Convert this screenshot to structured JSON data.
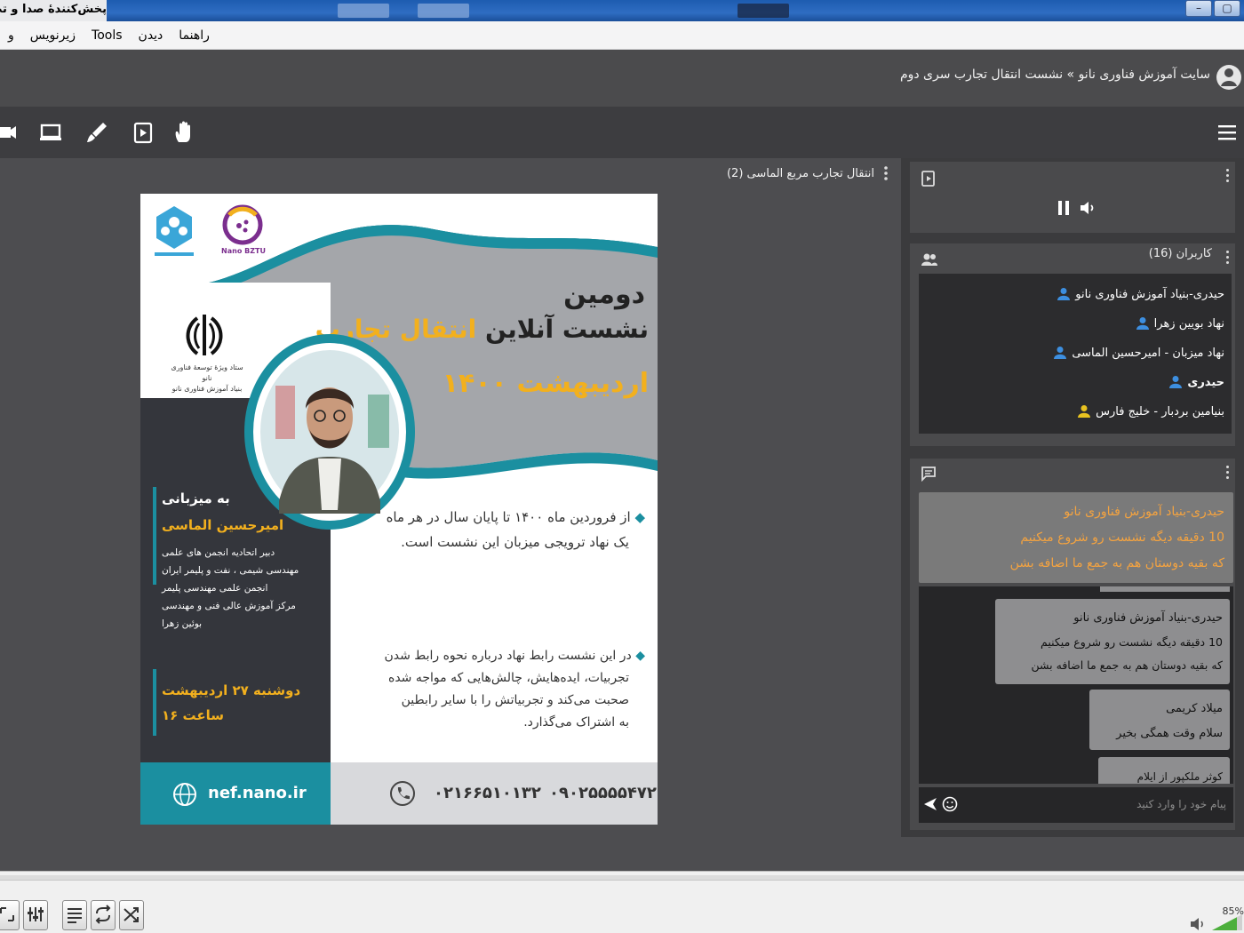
{
  "window": {
    "title": "پخش‌کنندهٔ صدا و تصویر"
  },
  "menu": {
    "items": [
      "راهنما",
      "دیدن",
      "Tools",
      "زیرنویس",
      "و"
    ]
  },
  "header": {
    "breadcrumb": "سایت آموزش فناوری نانو » نشست انتقال تجارب سری دوم"
  },
  "toolbar": {
    "tools": [
      "hand-icon",
      "presentation-icon",
      "pen-icon",
      "screen-icon",
      "camera-icon"
    ],
    "menu_icon": "hamburger-icon"
  },
  "presentation": {
    "title": "انتقال تجارب مربع الماسی (2)"
  },
  "slide": {
    "logo_right_caption": "Nano BZTU",
    "emblem_caption": "ستاد ویژهٔ توسعهٔ فناوری نانو\nبنیاد آموزش فناوری نانو",
    "heading_1": "دومین",
    "heading_2a": "نشست آنلاین",
    "heading_2b": "انتقال تجارب",
    "heading_3": "اردیبهشت ۱۴۰۰",
    "host_label": "به میزبانی",
    "host_name": "امیرحسین الماسی",
    "host_roles": [
      "دبیر اتحادیه انجمن های علمی",
      "مهندسی شیمی ، نفت و پلیمر ایران",
      "انجمن علمی مهندسی پلیمر",
      "مرکز آموزش عالی فنی و مهندسی",
      "بوئین زهرا"
    ],
    "date_line": "دوشنبه ۲۷ اردیبهشت",
    "time_line": "ساعت ۱۶",
    "bullet_1a": "از فروردین ماه ۱۴۰۰ تا پایان سال در هر ماه",
    "bullet_1b": "یک نهاد ترویجی میزبان این نشست است.",
    "bullet_2": [
      "در این نشست رابط نهاد درباره نحوه رابط شدن",
      "تجربیات، ایده‌هایش، چالش‌هایی که مواجه شده",
      "صحبت می‌کند و تجربیاتش را با سایر رابطین",
      "به اشتراک می‌گذارد."
    ],
    "website": "nef.nano.ir",
    "phone_1": "۰۲۱۶۶۵۱۰۱۳۲",
    "phone_2": "۰۹۰۲۵۵۵۵۴۷۲"
  },
  "users": {
    "title": "کاربران (16)",
    "list": [
      {
        "name": "حیدری-بنیاد آموزش فناوری نانو",
        "color": "#3d8fe0",
        "bold": false
      },
      {
        "name": "نهاد بویین زهرا",
        "color": "#3d8fe0",
        "bold": false
      },
      {
        "name": "نهاد میزبان - امیرحسین الماسی",
        "color": "#3d8fe0",
        "bold": false
      },
      {
        "name": "حیدری",
        "color": "#3d8fe0",
        "bold": true
      },
      {
        "name": "بنیامین بردبار - خلیج فارس",
        "color": "#e8c220",
        "bold": false
      }
    ]
  },
  "chat": {
    "pinned": [
      "حیدری-بنیاد آموزش فناوری نانو",
      "10 دقیقه دیگه نشست رو شروع میکنیم",
      "که بقیه دوستان هم به جمع ما اضافه بشن"
    ],
    "messages": [
      {
        "sender": "حیدری-بنیاد آموزش فناوری نانو",
        "lines": [
          "10 دقیقه دیگه نشست رو شروع میکنیم",
          "که بقیه دوستان هم به جمع ما اضافه بشن"
        ]
      },
      {
        "sender": "میلاد کریمی",
        "lines": [
          "سلام وقت همگی بخیر"
        ]
      },
      {
        "sender": "کوثر ملکپور از ایلام",
        "lines": []
      }
    ],
    "placeholder": "پیام خود را وارد کنید"
  },
  "player": {
    "zoom": "85%"
  },
  "colors": {
    "accent_teal": "#1b8fa0",
    "gold": "#f2b01e",
    "dark_panel": "#34363c"
  }
}
